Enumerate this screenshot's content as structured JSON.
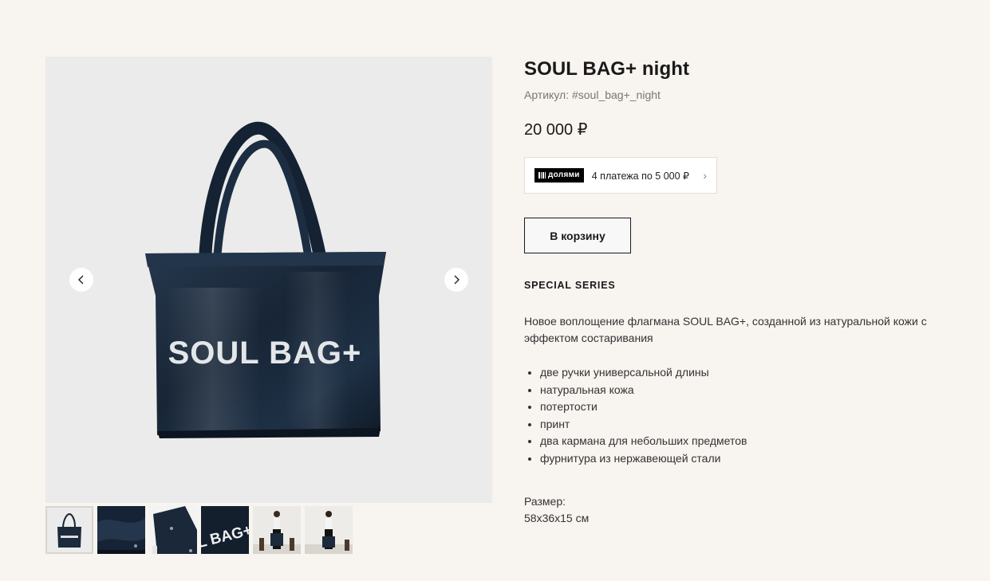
{
  "product": {
    "title": "SOUL BAG+ night",
    "sku": "Артикул: #soul_bag+_night",
    "price": "20 000 ₽",
    "bag_print": "SOUL BAG+"
  },
  "dolyami": {
    "logo": "долями",
    "text": "4 платежа по 5 000 ₽",
    "chevron": "›"
  },
  "cart_button": "В корзину",
  "series": "SPECIAL SERIES",
  "description": "Новое воплощение флагмана SOUL BAG+, созданной из натуральной кожи с эффектом состаривания",
  "features": [
    "две ручки универсальной длины",
    "натуральная кожа",
    "потертости",
    "принт",
    "два кармана для небольших предметов",
    "фурнитура из нержавеющей стали"
  ],
  "size": {
    "label": "Размер:",
    "value": "58х36х15 см"
  },
  "gallery": {
    "thumb_print": "L BAG+",
    "icons": {
      "prev": "chevron-left-icon",
      "next": "chevron-right-icon"
    },
    "thumbnails": [
      "bag-front",
      "leather-closeup",
      "bag-corner",
      "print-closeup",
      "model-front",
      "model-holding"
    ]
  },
  "colors": {
    "background": "#f8f4f0",
    "gallery_bg": "#ebebeb",
    "bag": "#1c2a3c",
    "text": "#1a1a1a",
    "muted": "#777777"
  }
}
